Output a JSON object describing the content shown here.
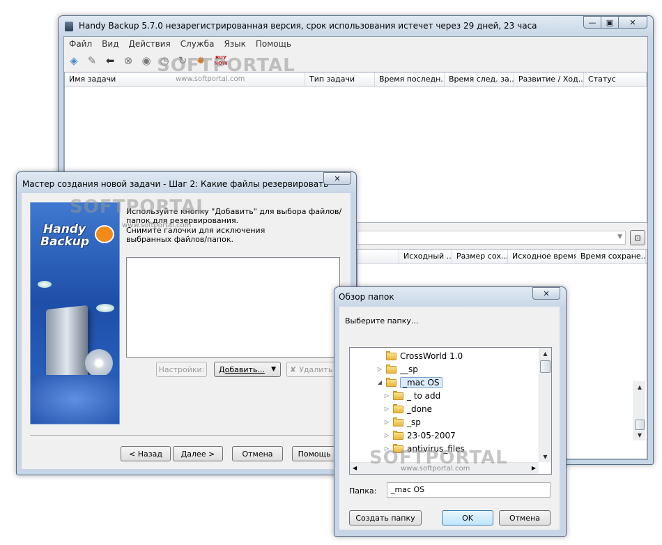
{
  "main_window": {
    "title": "Handy Backup 5.7.0 незарегистрированная версия, срок использования истечет через  29 дней, 23 часа",
    "menu": [
      "Файл",
      "Вид",
      "Действия",
      "Служба",
      "Язык",
      "Помощь"
    ],
    "toolbar_icons": [
      "new-task-icon",
      "edit-icon",
      "back-arrow-icon",
      "stop-icon",
      "run-icon",
      "schedule-icon",
      "refresh-icon",
      "options-icon",
      "buy-now-icon"
    ],
    "buy_now_label": "BUY NOW",
    "task_columns": [
      "Имя задачи",
      "Тип задачи",
      "Время последн...",
      "Время след. за...",
      "Развитие / Ход...",
      "Статус"
    ],
    "file_columns": [
      "Исходный ...",
      "Размер сох...",
      "Исходное время",
      "Время сохране..."
    ]
  },
  "wizard": {
    "title": "Мастер создания новой задачи - Шаг 2: Какие файлы резервировать",
    "logo_text_1": "Handy",
    "logo_text_2": "Backup",
    "instructions_line1": "Используйте кнопку \"Добавить\" для выбора файлов/папок для резервирования.",
    "instructions_line2": "Снимите галочки для исключения выбранных файлов/папок.",
    "settings_button": "Настройки:",
    "add_button": "Добавить...",
    "delete_button": "Удалить",
    "back_button": "< Назад",
    "next_button": "Далее >",
    "cancel_button": "Отмена",
    "help_button": "Помощь"
  },
  "browse": {
    "title": "Обзор папок",
    "prompt": "Выберите папку...",
    "tree": [
      {
        "label": "CrossWorld  1.0",
        "level": 1,
        "expander": "",
        "selected": false
      },
      {
        "label": "__sp",
        "level": 1,
        "expander": "▷",
        "selected": false
      },
      {
        "label": "_mac OS",
        "level": 1,
        "expander": "◢",
        "selected": true
      },
      {
        "label": "_ to add",
        "level": 2,
        "expander": "▷",
        "selected": false
      },
      {
        "label": "_done",
        "level": 2,
        "expander": "▷",
        "selected": false
      },
      {
        "label": "_sp",
        "level": 2,
        "expander": "▷",
        "selected": false
      },
      {
        "label": "23-05-2007",
        "level": 2,
        "expander": "▷",
        "selected": false
      },
      {
        "label": "antivirus_files",
        "level": 2,
        "expander": "▷",
        "selected": false
      }
    ],
    "folder_label": "Папка:",
    "folder_value": "_mac OS",
    "new_folder_button": "Создать папку",
    "ok_button": "OK",
    "cancel_button": "Отмена"
  },
  "watermark": {
    "brand": "SOFTPORTAL",
    "url": "www.softportal.com"
  }
}
